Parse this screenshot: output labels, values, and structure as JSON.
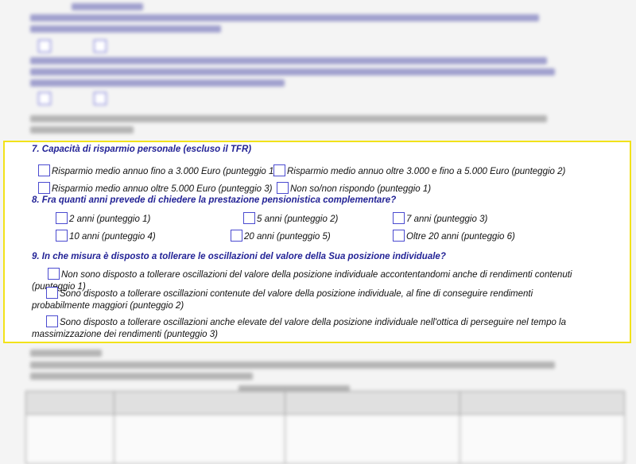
{
  "questions": {
    "q7": {
      "title": "7. Capacità di risparmio personale (escluso il TFR)",
      "options": [
        "Risparmio medio annuo fino a 3.000 Euro (punteggio 1)",
        "Risparmio medio annuo oltre 3.000 e fino a 5.000 Euro (punteggio 2)",
        "Risparmio medio annuo oltre 5.000 Euro (punteggio 3)",
        "Non so/non rispondo (punteggio 1)"
      ]
    },
    "q8": {
      "title": "8. Fra quanti anni prevede di chiedere la prestazione pensionistica complementare?",
      "options": [
        "2 anni (punteggio 1)",
        "5 anni (punteggio 2)",
        "7 anni (punteggio 3)",
        "10 anni (punteggio 4)",
        "20 anni (punteggio 5)",
        "Oltre 20 anni (punteggio 6)"
      ]
    },
    "q9": {
      "title": "9. In che misura è disposto a tollerare le oscillazioni del valore della Sua posizione individuale?",
      "options": [
        "Non sono disposto a tollerare oscillazioni del valore della posizione individuale accontentandomi anche di rendimenti contenuti (punteggio 1)",
        "Sono disposto a tollerare oscillazioni contenute del valore della posizione individuale, al fine di conseguire rendimenti probabilmente maggiori (punteggio 2)",
        "Sono disposto a tollerare oscillazioni anche elevate del valore della posizione individuale nell'ottica di perseguire nel tempo la massimizzazione dei rendimenti (punteggio 3)"
      ]
    }
  },
  "colors": {
    "highlight_border": "#f2e21a",
    "question_text": "#232396",
    "checkbox_border": "#4b4bd0"
  }
}
